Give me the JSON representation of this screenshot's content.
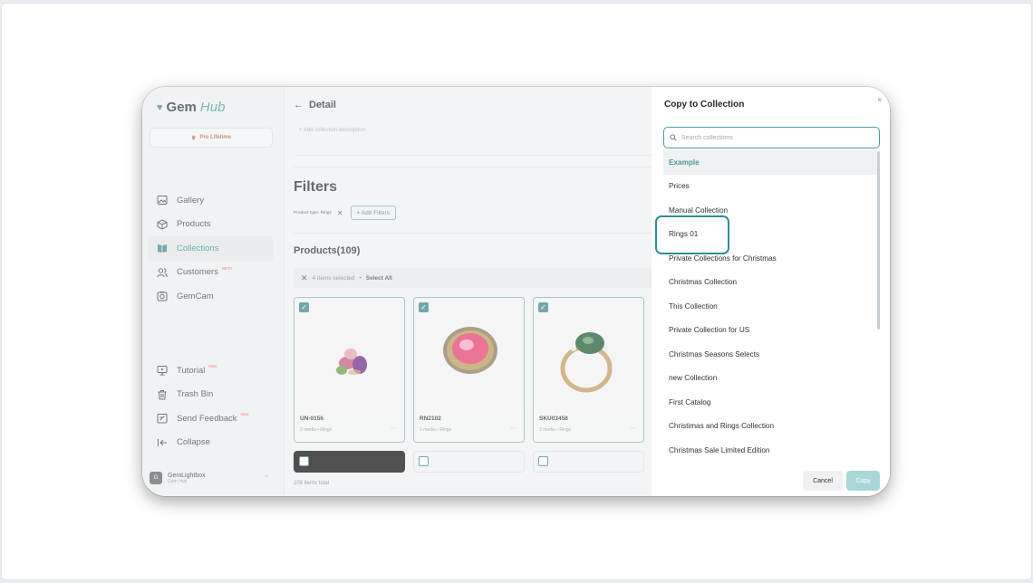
{
  "sidebar": {
    "brand_gem": "Gem",
    "brand_hub": "Hub",
    "pro_label": "Pro Lifetime",
    "nav": [
      {
        "label": "Gallery",
        "icon": "image-icon"
      },
      {
        "label": "Products",
        "icon": "box-icon"
      },
      {
        "label": "Collections",
        "icon": "book-icon",
        "active": true
      },
      {
        "label": "Customers",
        "icon": "users-icon",
        "badge": "BETA"
      },
      {
        "label": "GemCam",
        "icon": "camera-icon"
      }
    ],
    "nav_bottom": [
      {
        "label": "Tutorial",
        "icon": "monitor-icon",
        "badge": "New"
      },
      {
        "label": "Trash Bin",
        "icon": "trash-icon"
      },
      {
        "label": "Send Feedback",
        "icon": "feedback-icon",
        "badge": "New"
      },
      {
        "label": "Collapse",
        "icon": "collapse-icon"
      }
    ],
    "account_name": "GemLightbox",
    "account_sub": "Gem Hub"
  },
  "main": {
    "title": "Detail",
    "description_placeholder": "+ Add collection description",
    "filters_title": "Filters",
    "filter_chip": "Product type: Rings",
    "add_filters": "+ Add Filters",
    "products_title": "Products(109)",
    "selection_text": "4 items selected",
    "select_all": "Select All",
    "products": [
      {
        "sku": "UN-0156",
        "meta": "2 media • Rings"
      },
      {
        "sku": "RN2102",
        "meta": "1 media • Rings"
      },
      {
        "sku": "SKU03458",
        "meta": "3 media • Rings"
      }
    ],
    "total": "109 items total"
  },
  "modal": {
    "title": "Copy to Collection",
    "close": "×",
    "search_placeholder": "Search collections",
    "search_value": "",
    "items": [
      "Example",
      "Prices",
      "Manual Collection",
      "Rings 01",
      "Private Collections for Christmas",
      "Christmas Collection",
      "This Collection",
      "Private Collection for US",
      "Christmas Seasons Selects",
      "new Collection",
      "First Catalog",
      "Christimas and Rings Collection",
      "Christmas Sale Limited Edition"
    ],
    "highlighted_index": 0,
    "cancel_label": "Cancel",
    "copy_label": "Copy"
  },
  "colors": {
    "accent": "#4c9b9c",
    "focus": "#2f8d95"
  }
}
